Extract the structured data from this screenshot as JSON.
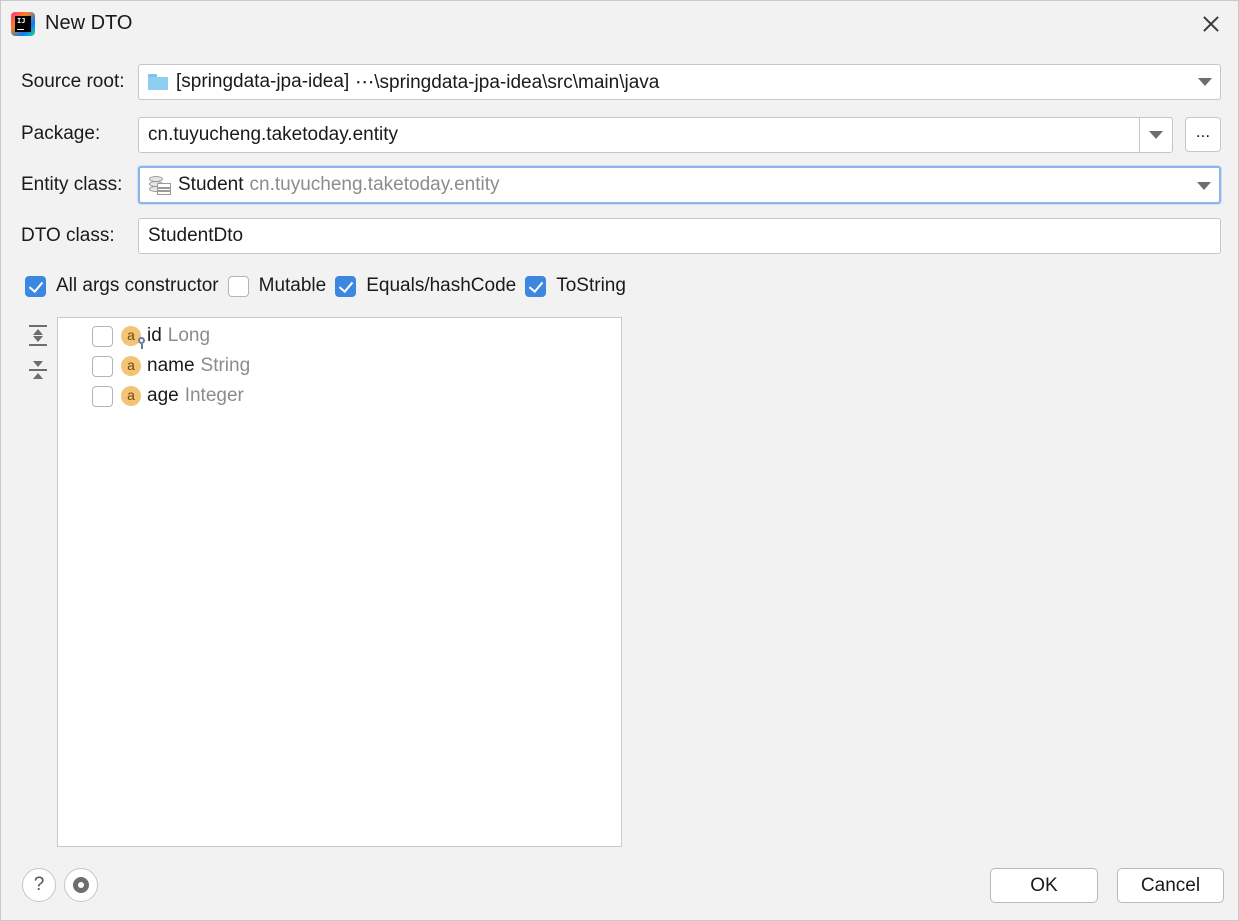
{
  "window": {
    "title": "New DTO"
  },
  "source_root": {
    "label": "Source root:",
    "module": "[springdata-jpa-idea]",
    "path": "⋯\\springdata-jpa-idea\\src\\main\\java"
  },
  "package": {
    "label": "Package:",
    "value": "cn.tuyucheng.taketoday.entity",
    "browse_label": "..."
  },
  "entity_class": {
    "label": "Entity class:",
    "name": "Student",
    "package": "cn.tuyucheng.taketoday.entity"
  },
  "dto_class": {
    "label": "DTO class:",
    "value": "StudentDto"
  },
  "options": [
    {
      "label": "All args constructor",
      "checked": true
    },
    {
      "label": "Mutable",
      "checked": false
    },
    {
      "label": "Equals/hashCode",
      "checked": true
    },
    {
      "label": "ToString",
      "checked": true
    }
  ],
  "fields": [
    {
      "icon": "a",
      "name": "id",
      "type": "Long",
      "checked": false,
      "is_id": true
    },
    {
      "icon": "a",
      "name": "name",
      "type": "String",
      "checked": false,
      "is_id": false
    },
    {
      "icon": "a",
      "name": "age",
      "type": "Integer",
      "checked": false,
      "is_id": false
    }
  ],
  "footer": {
    "help_label": "?",
    "ok_label": "OK",
    "cancel_label": "Cancel"
  },
  "icons": {
    "app": "intellij-idea-icon",
    "close": "close-icon",
    "folder": "folder-icon",
    "entity": "database-table-icon",
    "expand_all": "expand-all-icon",
    "collapse_all": "collapse-all-icon",
    "settings": "gear-icon"
  },
  "colors": {
    "accent": "#3c88e0",
    "focus_ring": "#8fb4e8",
    "field_icon": "#f4c476",
    "folder": "#8dcff0"
  }
}
